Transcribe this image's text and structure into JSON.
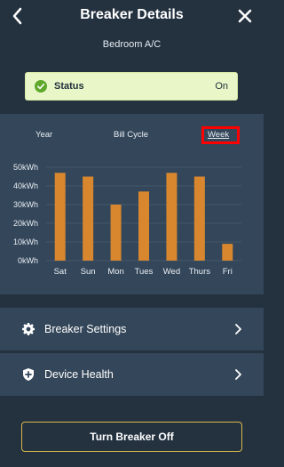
{
  "header": {
    "title": "Breaker Details",
    "back_icon": "chevron-left-icon",
    "close_icon": "close-icon"
  },
  "device": {
    "name": "Bedroom A/C"
  },
  "status": {
    "label": "Status",
    "value": "On",
    "icon": "check-circle-icon",
    "color": "#e9f7c8"
  },
  "tabs": [
    {
      "label": "Year",
      "selected": false
    },
    {
      "label": "Bill Cycle",
      "selected": false
    },
    {
      "label": "Week",
      "selected": true
    }
  ],
  "chart_data": {
    "type": "bar",
    "categories": [
      "Sat",
      "Sun",
      "Mon",
      "Tues",
      "Wed",
      "Thurs",
      "Fri"
    ],
    "values": [
      47,
      45,
      30,
      37,
      47,
      45,
      9
    ],
    "y_ticks": [
      "50kWh",
      "40kWh",
      "30kWh",
      "20kWh",
      "10kWh",
      "0kWh"
    ],
    "ylim": [
      0,
      50
    ],
    "bar_color": "#d8872f",
    "grid": true
  },
  "menu": [
    {
      "label": "Breaker Settings",
      "icon": "gear-icon"
    },
    {
      "label": "Device Health",
      "icon": "shield-plus-icon"
    }
  ],
  "actions": {
    "turn_off_label": "Turn Breaker Off",
    "border_color": "#d9b84a"
  }
}
